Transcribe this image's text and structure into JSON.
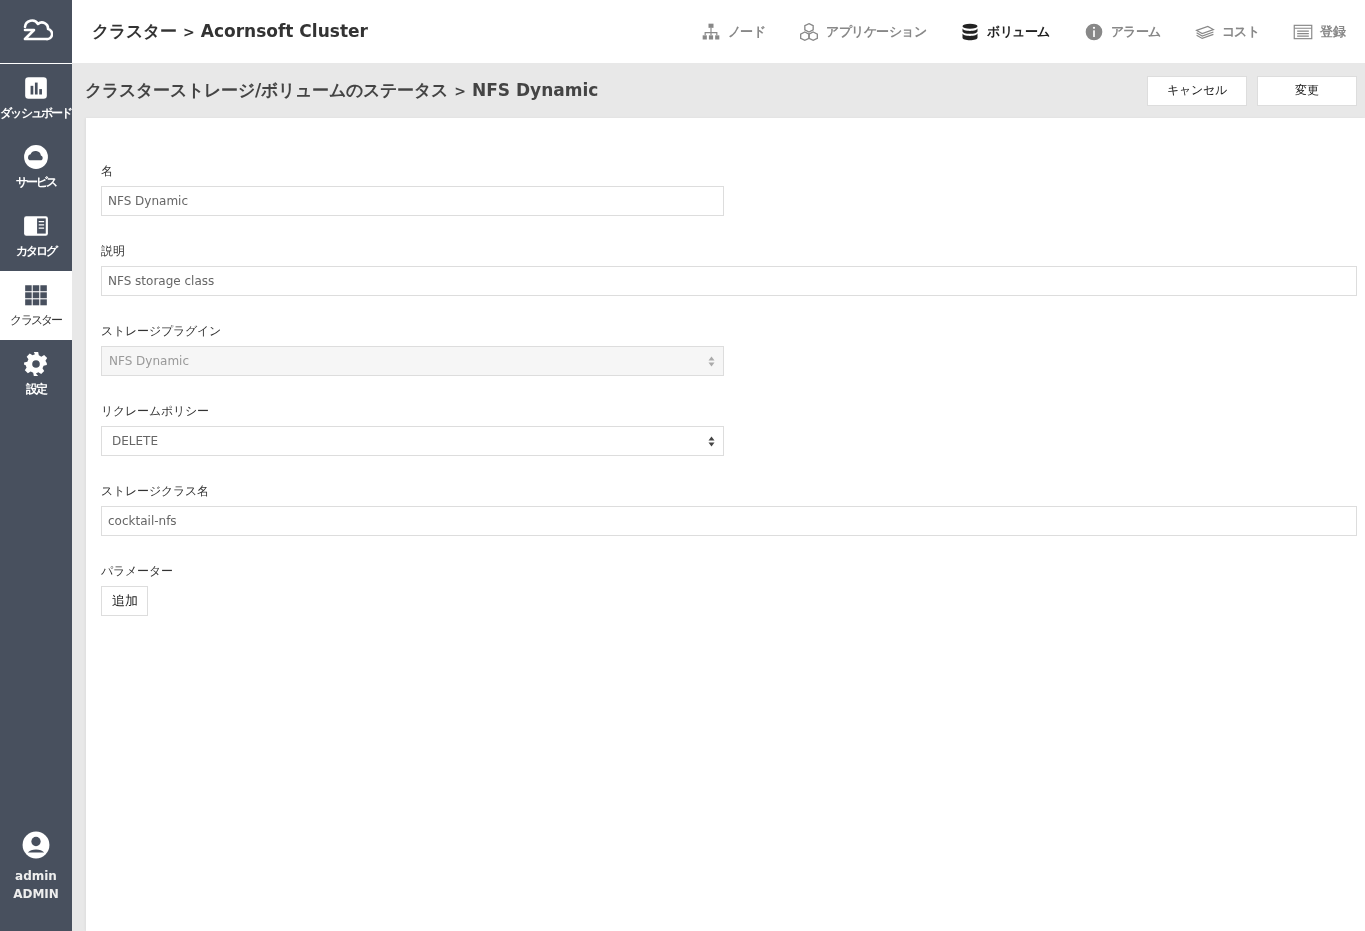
{
  "sidebar": {
    "items": [
      {
        "label": "ダッシュボード",
        "selected": false
      },
      {
        "label": "サービス",
        "selected": false
      },
      {
        "label": "カタログ",
        "selected": false
      },
      {
        "label": "クラスター",
        "selected": true
      },
      {
        "label": "設定",
        "selected": false
      }
    ],
    "user": {
      "name": "admin",
      "role": "ADMIN"
    }
  },
  "header": {
    "breadcrumb": [
      "クラスター",
      ">",
      "Acornsoft Cluster"
    ],
    "nav": [
      {
        "label": "ノード",
        "selected": false
      },
      {
        "label": "アプリケーション",
        "selected": false
      },
      {
        "label": "ボリューム",
        "selected": true
      },
      {
        "label": "アラーム",
        "selected": false
      },
      {
        "label": "コスト",
        "selected": false
      },
      {
        "label": "登録",
        "selected": false
      }
    ]
  },
  "page": {
    "title": [
      "クラスターストレージ/ボリュームのステータス",
      ">",
      "NFS Dynamic"
    ],
    "buttons": [
      "キャンセル",
      "変更"
    ]
  },
  "form": {
    "fields": [
      {
        "label": "名",
        "kind": "text",
        "wide": false,
        "disabled": false,
        "value": "NFS Dynamic"
      },
      {
        "label": "説明",
        "kind": "text",
        "wide": true,
        "disabled": false,
        "value": "NFS storage class"
      },
      {
        "label": "ストレージプラグイン",
        "kind": "select",
        "wide": false,
        "disabled": true,
        "value": "NFS Dynamic"
      },
      {
        "label": "リクレームポリシー",
        "kind": "select",
        "wide": false,
        "disabled": false,
        "value": "DELETE"
      },
      {
        "label": "ストレージクラス名",
        "kind": "text",
        "wide": true,
        "disabled": false,
        "value": "cocktail-nfs"
      }
    ],
    "parameters": {
      "label": "パラメーター",
      "button": "追加"
    }
  }
}
